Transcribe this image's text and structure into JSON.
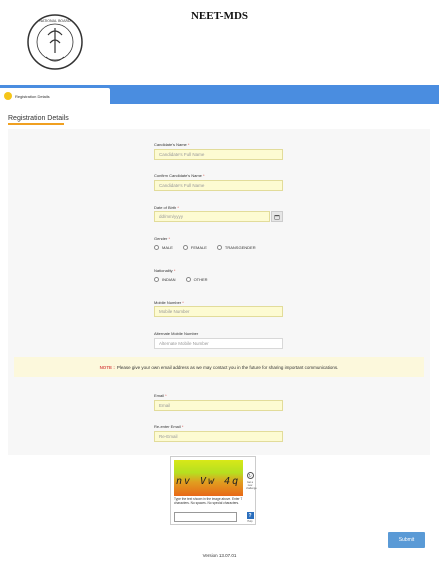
{
  "header": {
    "title": "NEET-MDS",
    "logo_text": "NATIONAL BOARD OF EXAMINATIONS"
  },
  "tabs": [
    {
      "label": "Registration Details"
    }
  ],
  "section": {
    "title": "Registration Details"
  },
  "form": {
    "candidate_name": {
      "label": "Candidate's Name",
      "placeholder": "Candidate's Full Name"
    },
    "confirm_name": {
      "label": "Confirm Candidate's Name",
      "placeholder": "Candidate's Full Name"
    },
    "dob": {
      "label": "Date of Birth",
      "placeholder": "dd/mm/yyyy"
    },
    "gender": {
      "label": "Gender",
      "options": [
        "MALE",
        "FEMALE",
        "TRANSGENDER"
      ]
    },
    "nationality": {
      "label": "Nationality",
      "options": [
        "INDIAN",
        "OTHER"
      ]
    },
    "mobile": {
      "label": "Mobile Number",
      "placeholder": "Mobile Number"
    },
    "alt_mobile": {
      "label": "Alternate Mobile Number",
      "placeholder": "Alternate Mobile Number"
    },
    "note": {
      "key": "NOTE :",
      "text": "Please give your own email address as we may contact you in the future for sharing important communications."
    },
    "email": {
      "label": "Email",
      "placeholder": "Email"
    },
    "re_email": {
      "label": "Re-enter Email",
      "placeholder": "Re-Email"
    },
    "required_mark": "*"
  },
  "captcha": {
    "text": "nv Vw 4q y",
    "refresh_label": "Get a new challenge",
    "instructions": "Type the text shown in the image above. Enter 7 characters. No spaces. No special characters.",
    "help_label": "Help"
  },
  "submit_label": "Submit",
  "version": "Version 13.07.01",
  "colors": {
    "tabbar": "#4a8de0",
    "field_bg": "#fdfbd2",
    "accent_underline": "#f0a020",
    "submit": "#5a9ad6",
    "required": "#d9534f"
  }
}
